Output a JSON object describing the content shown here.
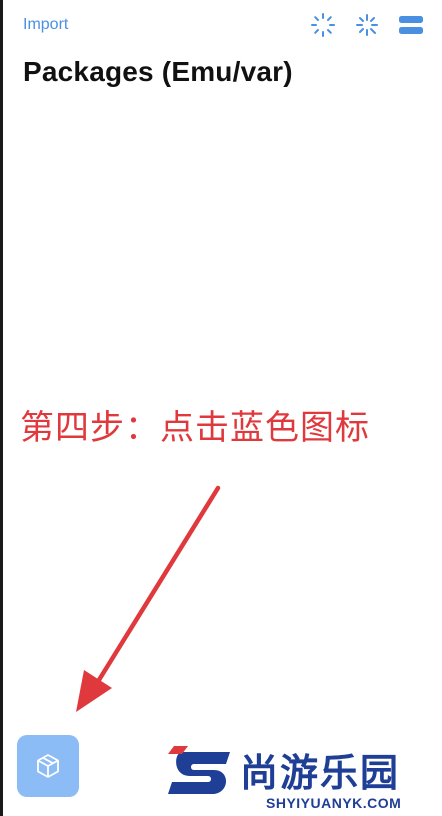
{
  "header": {
    "import_label": "Import",
    "title": "Packages (Emu/var)"
  },
  "toolbar": {
    "icons": [
      "loading-spinner-icon",
      "sparkle-icon",
      "list-toggle-icon"
    ],
    "accent": "#4a90e2"
  },
  "annotation": {
    "text": "第四步：点击蓝色图标",
    "color": "#e0393d"
  },
  "floating_button": {
    "icon": "package-icon",
    "color": "#8bbcf5"
  },
  "watermark": {
    "name": "尚游乐园",
    "url": "SHYIYUANYK.COM",
    "color": "#1f3f96"
  }
}
